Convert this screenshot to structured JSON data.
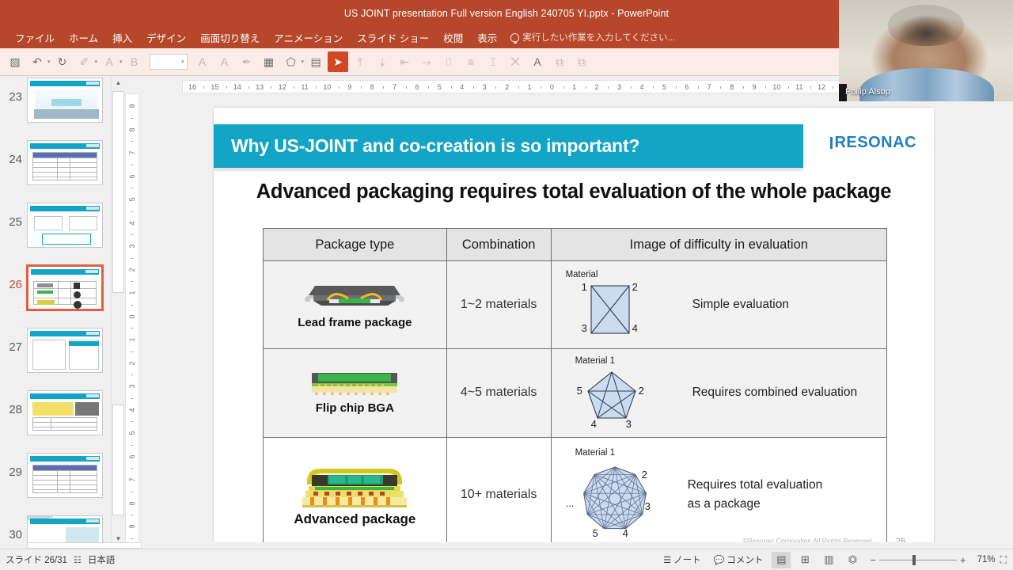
{
  "window": {
    "title": "US JOINT presentation Full version  English 240705 YI.pptx - PowerPoint"
  },
  "menu": {
    "items": [
      "ファイル",
      "ホーム",
      "挿入",
      "デザイン",
      "画面切り替え",
      "アニメーション",
      "スライド ショー",
      "校閲",
      "表示"
    ],
    "tell_me": "実行したい作業を入力してください...",
    "tell_me_icon": "lightbulb-icon"
  },
  "toolbar": {
    "icons": [
      {
        "name": "save-icon",
        "glyph": "▧",
        "state": "normal"
      },
      {
        "name": "undo-icon",
        "glyph": "↶",
        "state": "normal",
        "caret": true
      },
      {
        "name": "redo-icon",
        "glyph": "↻",
        "state": "normal"
      },
      {
        "name": "format-painter-icon",
        "glyph": "✐",
        "state": "disabled",
        "caret": true
      },
      {
        "name": "font-color-icon",
        "glyph": "A",
        "state": "disabled",
        "caret": true
      },
      {
        "name": "bold-icon",
        "glyph": "B",
        "state": "disabled"
      },
      {
        "name": "increase-font-size-icon",
        "glyph": "A",
        "state": "disabled"
      },
      {
        "name": "decrease-font-size-icon",
        "glyph": "A",
        "state": "disabled"
      },
      {
        "name": "eyedropper-icon",
        "glyph": "✒",
        "state": "disabled"
      },
      {
        "name": "insert-table-icon",
        "glyph": "▦",
        "state": "normal"
      },
      {
        "name": "shapes-icon",
        "glyph": "⬠",
        "state": "normal",
        "caret": true
      },
      {
        "name": "text-box-icon",
        "glyph": "▤",
        "state": "normal"
      },
      {
        "name": "select-pointer-icon",
        "glyph": "➤",
        "state": "selected"
      },
      {
        "name": "align-top-icon",
        "glyph": "⤒",
        "state": "disabled"
      },
      {
        "name": "distribute-vertical-icon",
        "glyph": "⤓",
        "state": "disabled"
      },
      {
        "name": "align-left-icon",
        "glyph": "⇤",
        "state": "disabled"
      },
      {
        "name": "align-bottom-icon",
        "glyph": "⤑",
        "state": "disabled"
      },
      {
        "name": "align-middle-icon",
        "glyph": "⌷",
        "state": "disabled"
      },
      {
        "name": "align-center-icon",
        "glyph": "≡",
        "state": "disabled"
      },
      {
        "name": "distribute-horizontal-icon",
        "glyph": "⌶",
        "state": "disabled"
      },
      {
        "name": "group-icon",
        "glyph": "⨉",
        "state": "disabled"
      },
      {
        "name": "text-underline-color-icon",
        "glyph": "A",
        "state": "normal"
      },
      {
        "name": "bring-forward-icon",
        "glyph": "⧉",
        "state": "disabled"
      },
      {
        "name": "send-backward-icon",
        "glyph": "⧉",
        "state": "disabled"
      }
    ],
    "font_size_value": ""
  },
  "ruler": {
    "horizontal_labels": [
      "16",
      "15",
      "14",
      "13",
      "12",
      "11",
      "10",
      "9",
      "8",
      "7",
      "6",
      "5",
      "4",
      "3",
      "2",
      "1",
      "0",
      "1",
      "2",
      "3",
      "4",
      "5",
      "6",
      "7",
      "8",
      "9",
      "10",
      "11",
      "12"
    ],
    "vertical_labels": [
      "9",
      "8",
      "7",
      "6",
      "5",
      "4",
      "3",
      "2",
      "1",
      "0",
      "1",
      "2",
      "3",
      "4",
      "5",
      "6",
      "7",
      "8",
      "9"
    ]
  },
  "thumbnails": {
    "items": [
      {
        "number": "23",
        "active": false,
        "kind": "map"
      },
      {
        "number": "24",
        "active": false,
        "kind": "table"
      },
      {
        "number": "25",
        "active": false,
        "kind": "diagram"
      },
      {
        "number": "26",
        "active": true,
        "kind": "table3"
      },
      {
        "number": "27",
        "active": false,
        "kind": "twopanel"
      },
      {
        "number": "28",
        "active": false,
        "kind": "yellowline"
      },
      {
        "number": "29",
        "active": false,
        "kind": "table"
      },
      {
        "number": "30",
        "active": false,
        "kind": "maplocation"
      }
    ]
  },
  "slide": {
    "banner_title": "Why US-JOINT and co-creation is so important?",
    "logo_text": "RESONAC",
    "subtitle": "Advanced packaging requires total evaluation of the whole package",
    "footer_copyright": "©Resonac Corporation All Rights Reserved.",
    "footer_page": "26",
    "table": {
      "headers": [
        "Package type",
        "Combination",
        "Image of difficulty in evaluation"
      ],
      "rows": [
        {
          "package_label": "Lead frame package",
          "package_art": "lead-frame-package-illustration",
          "combination": "1~2 materials",
          "material_caption": "Material",
          "node_labels": [
            "1",
            "2",
            "3",
            "4"
          ],
          "polygon_sides": 4,
          "evaluation": "Simple evaluation"
        },
        {
          "package_label": "Flip chip BGA",
          "package_art": "flip-chip-bga-illustration",
          "combination": "4~5 materials",
          "material_caption": "Material 1",
          "node_labels": [
            "2",
            "3",
            "4",
            "5"
          ],
          "polygon_sides": 5,
          "evaluation": "Requires combined evaluation"
        },
        {
          "package_label": "Advanced package",
          "package_art": "advanced-package-illustration",
          "combination": "10+ materials",
          "material_caption": "Material 1",
          "node_labels": [
            "2",
            "3",
            "4",
            "5",
            "..."
          ],
          "polygon_sides": 9,
          "evaluation_line1": "Requires total evaluation",
          "evaluation_line2": "as a package"
        }
      ]
    }
  },
  "status_bar": {
    "slide_indicator": "スライド 26/31",
    "spellcheck_icon": "spellcheck-icon",
    "language": "日本語",
    "notes_label": "ノート",
    "notes_icon": "notes-icon",
    "comments_label": "コメント",
    "comments_icon": "comment-icon",
    "view_buttons": [
      {
        "name": "normal-view-button",
        "glyph": "▤",
        "active": true
      },
      {
        "name": "slide-sorter-view-button",
        "glyph": "⊞",
        "active": false
      },
      {
        "name": "reading-view-button",
        "glyph": "▥",
        "active": false
      },
      {
        "name": "slideshow-button",
        "glyph": "▭",
        "active": false
      }
    ],
    "zoom_out_icon": "minus-icon",
    "zoom_in_icon": "plus-icon",
    "zoom_level": "71%",
    "fit_icon": "fit-to-window-icon"
  },
  "video": {
    "participant_name": "Philip Alsop"
  },
  "colors": {
    "ribbon_red": "#b7472a",
    "accent_teal": "#12a5c6",
    "logo_blue": "#1f7fbf",
    "selected_orange": "#d24726",
    "active_thumb_border": "#e0603f"
  }
}
